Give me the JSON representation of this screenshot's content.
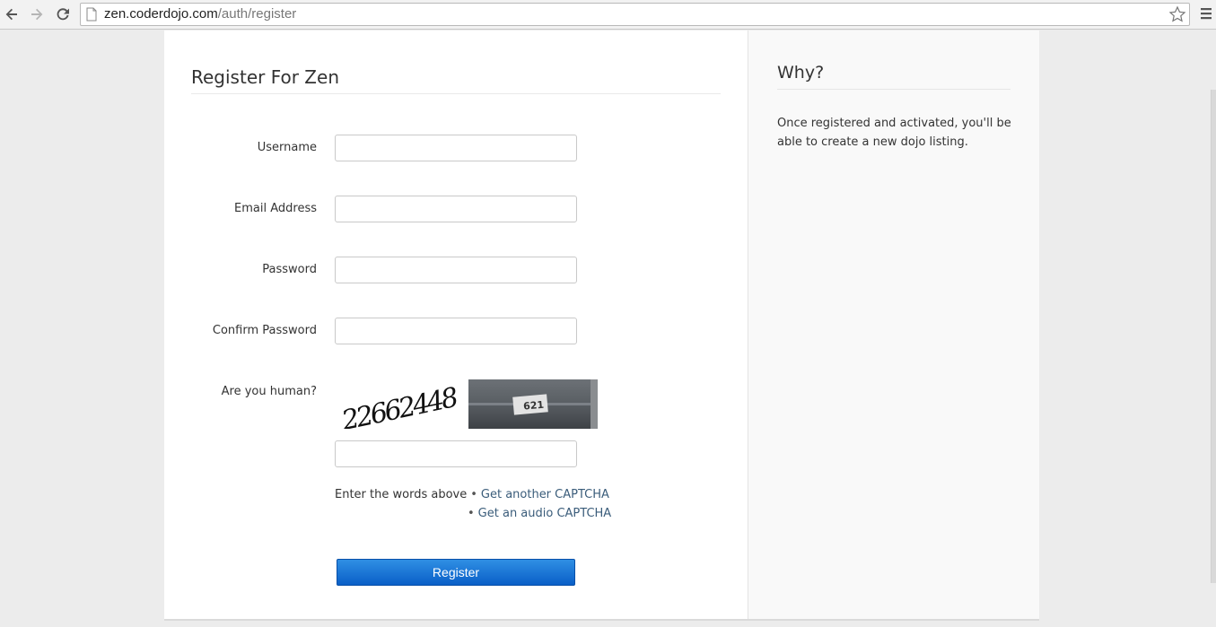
{
  "browser": {
    "url_host": "zen.coderdojo.com",
    "url_path": "/auth/register"
  },
  "form": {
    "title": "Register For Zen",
    "fields": {
      "username": {
        "label": "Username",
        "value": ""
      },
      "email": {
        "label": "Email Address",
        "value": ""
      },
      "password": {
        "label": "Password",
        "value": ""
      },
      "confirm_password": {
        "label": "Confirm Password",
        "value": ""
      }
    },
    "captcha": {
      "label": "Are you human?",
      "challenge_text": "22662448",
      "photo_text": "621",
      "response_value": "",
      "instruction": "Enter the words above",
      "another_link": "Get another CAPTCHA",
      "audio_link": "Get an audio CAPTCHA"
    },
    "register_label": "Register"
  },
  "sidebar": {
    "title": "Why?",
    "text": "Once registered and activated, you'll be able to create a new dojo listing."
  },
  "colors": {
    "page_background": "#ececec",
    "button_blue": "#0a5fc7",
    "link": "#3a5c7a"
  }
}
